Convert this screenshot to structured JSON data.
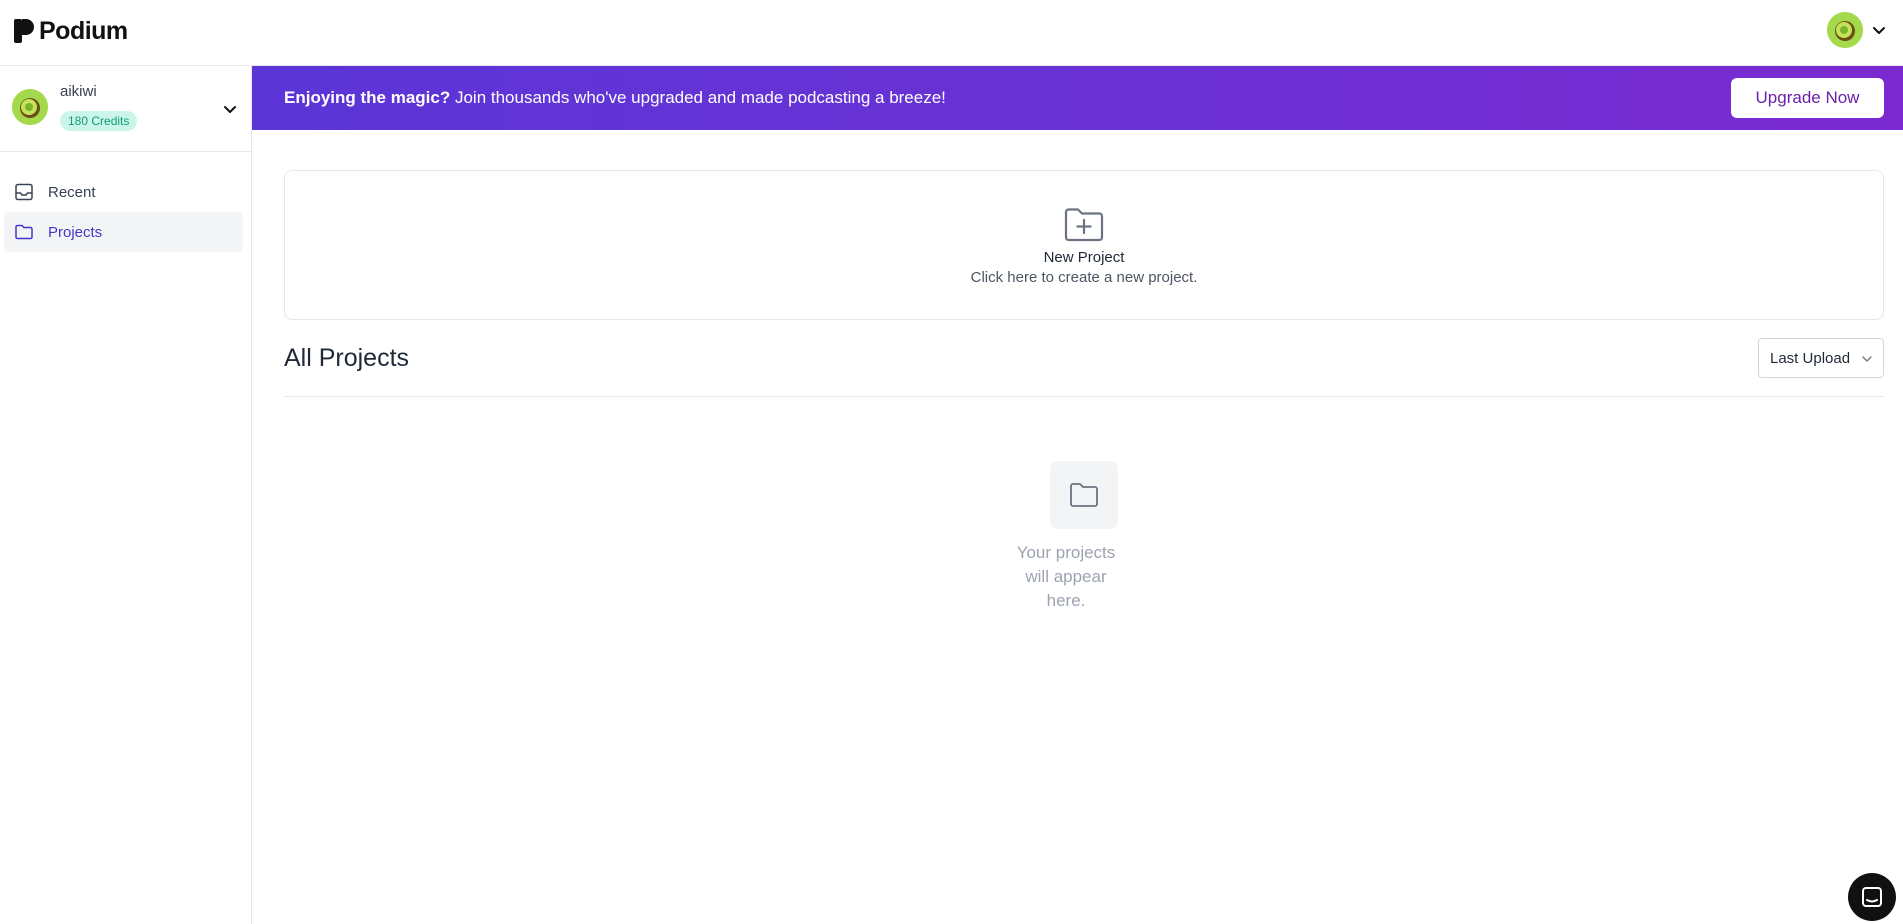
{
  "app": {
    "logo_text": "Podium"
  },
  "account": {
    "name": "aikiwi",
    "credits": "180 Credits"
  },
  "sidebar": {
    "items": [
      {
        "label": "Recent",
        "icon": "inbox-icon",
        "active": false
      },
      {
        "label": "Projects",
        "icon": "folder-icon",
        "active": true
      }
    ]
  },
  "banner": {
    "bold_text": "Enjoying the magic?",
    "text": " Join thousands who've upgraded and made podcasting a breeze!",
    "button_label": "Upgrade Now"
  },
  "new_project": {
    "title": "New Project",
    "subtitle": "Click here to create a new project."
  },
  "projects": {
    "title": "All Projects",
    "sort_value": "Last Upload",
    "empty_message": "Your projects will appear here."
  },
  "colors": {
    "accent": "#4338ca",
    "banner_start": "#5b35d6",
    "banner_end": "#7a2ad0",
    "credits_bg": "#ccf5ea",
    "credits_text": "#0f9c7a",
    "avatar": "#a3d94a"
  }
}
